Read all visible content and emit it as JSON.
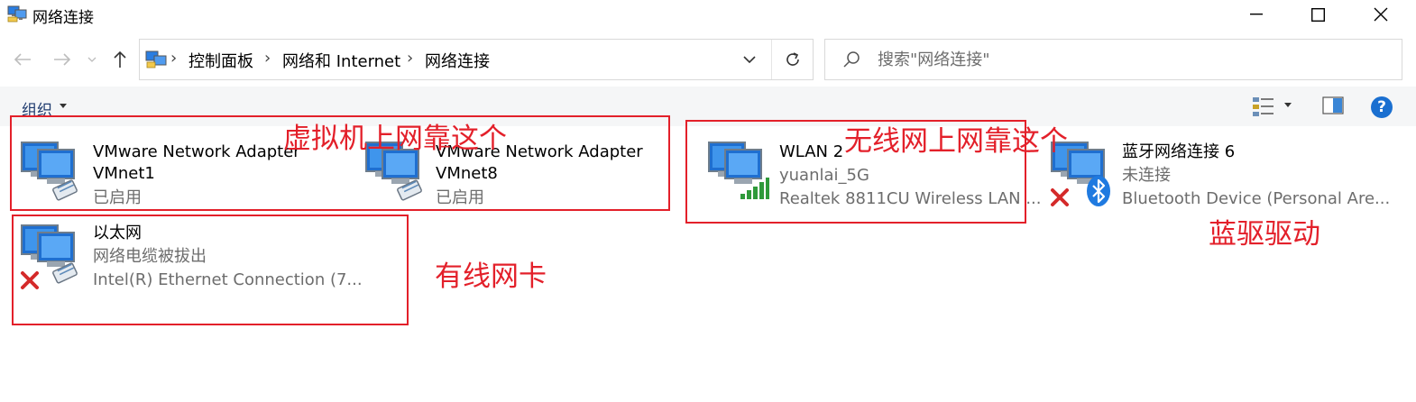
{
  "window": {
    "title": "网络连接"
  },
  "address": {
    "crumbs": [
      "控制面板",
      "网络和 Internet",
      "网络连接"
    ],
    "separator": "›"
  },
  "search": {
    "placeholder": "搜索\"网络连接\""
  },
  "toolbar": {
    "organize_label": "组织",
    "help_label": "?"
  },
  "items": [
    {
      "name": "VMware Network Adapter",
      "line2": "VMnet1",
      "line3": "已启用",
      "icon": "network-adapter-icon"
    },
    {
      "name": "VMware Network Adapter",
      "line2": "VMnet8",
      "line3": "已启用",
      "icon": "network-adapter-icon"
    },
    {
      "name": "WLAN 2",
      "line2": "yuanlai_5G",
      "line3": "Realtek 8811CU Wireless LAN ...",
      "icon": "wifi-signal-icon"
    },
    {
      "name": "蓝牙网络连接 6",
      "line2": "未连接",
      "line3": "Bluetooth Device (Personal Are...",
      "icon": "bluetooth-icon"
    },
    {
      "name": "以太网",
      "line2": "网络电缆被拔出",
      "line3": "Intel(R) Ethernet Connection (7...",
      "icon": "disconnected-x-icon"
    }
  ],
  "annotations": {
    "vm": "虚拟机上网靠这个",
    "wireless": "无线网上网靠这个",
    "bluetooth": "蓝驱驱动",
    "wired": "有线网卡"
  },
  "colors": {
    "annotation": "#e3202a",
    "monitor_blue": "#1f6fd0",
    "help_blue": "#1a6fd0",
    "status_x": "#d42a2a"
  }
}
